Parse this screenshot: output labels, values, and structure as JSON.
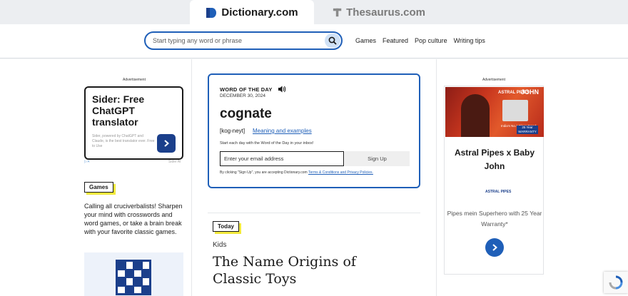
{
  "tabs": {
    "dictionary": "Dictionary.com",
    "thesaurus": "Thesaurus.com"
  },
  "header": {
    "search_placeholder": "Start typing any word or phrase",
    "nav": [
      "Games",
      "Featured",
      "Pop culture",
      "Writing tips"
    ]
  },
  "left_ad": {
    "label": "Advertisement",
    "title": "Sider: Free ChatGPT translator",
    "subtitle": "Sider, powered by ChatGPT and Claude, is the best translator ever. Free to Use",
    "footer_right": "Sider AI"
  },
  "games": {
    "badge": "Games",
    "text": "Calling all cruciverbalists! Sharpen your mind with crosswords and word games, or take a brain break with your favorite classic games."
  },
  "wotd": {
    "label": "WORD OF THE DAY",
    "date": "DECEMBER 30, 2024",
    "word": "cognate",
    "pronunciation": "[kog-neyt]",
    "link": "Meaning and examples",
    "start_text": "Start each day with the Word of the Day in your inbox!",
    "email_placeholder": "Enter your email address",
    "signup": "Sign Up",
    "terms_prefix": "By clicking \"Sign Up\", you are accepting Dictionary.com",
    "terms_link": "Terms & Conditions and Privacy Policies."
  },
  "today": {
    "badge": "Today",
    "category": "Kids",
    "headline": "The Name Origins of Classic Toys"
  },
  "right_ad": {
    "label": "Advertisement",
    "banner_brand": "ASTRAL PIPES",
    "banner_john": "JOHN",
    "banner_tag": "India's No.1 Pipes Brand",
    "banner_warranty": "25 Year WARRANTY",
    "title": "Astral Pipes x Baby John",
    "logo": "ASTRAL PIPES",
    "subtitle": "Pipes mein Superhero with 25 Year Warranty*"
  },
  "colors": {
    "brand_blue": "#1f5fb8",
    "highlight_yellow": "#f2e93c"
  }
}
